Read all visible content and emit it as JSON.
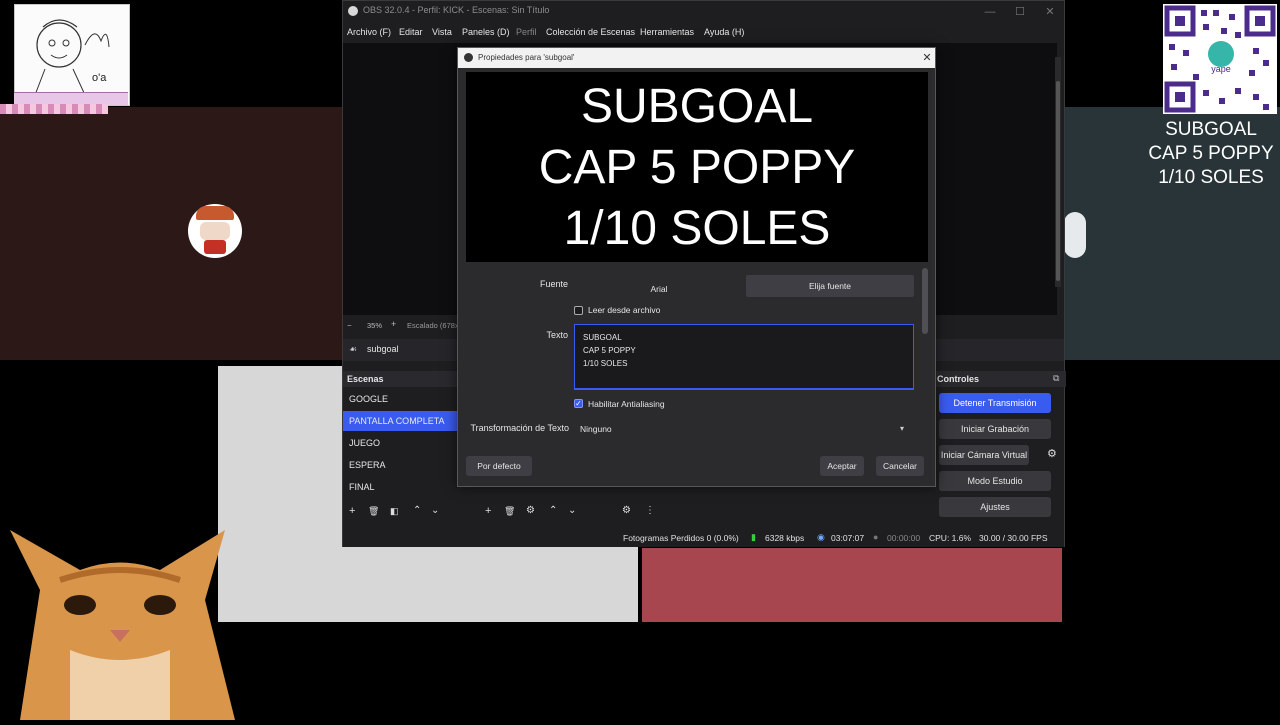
{
  "overlay": {
    "drawing_label": "o'a",
    "goal_lines": [
      "SUBGOAL",
      "CAP 5 POPPY",
      "1/10 SOLES"
    ]
  },
  "obs": {
    "title": "OBS 32.0.4 - Perfil: KICK - Escenas: Sin Título",
    "menu": [
      "Archivo (F)",
      "Editar",
      "Vista",
      "Paneles (D)",
      "Perfil",
      "Colección de Escenas",
      "Herramientas",
      "Ayuda (H)"
    ],
    "zoom": "35%",
    "zoom_mode": "Escalado (678x",
    "source_name": "subgoal",
    "scenes_title": "Escenas",
    "scenes": [
      "GOOGLE",
      "PANTALLA COMPLETA",
      "JUEGO",
      "ESPERA",
      "FINAL"
    ],
    "controls_title": "Controles",
    "controls": [
      "Detener Transmisión",
      "Iniciar Grabación",
      "Iniciar Cámara Virtual",
      "Modo Estudio",
      "Ajustes"
    ],
    "status": {
      "dropped": "Fotogramas Perdidos 0 (0.0%)",
      "bitrate": "6328 kbps",
      "stream_time": "03:07:07",
      "rec_time": "00:00:00",
      "cpu": "CPU: 1.6%",
      "fps": "30.00 / 30.00 FPS"
    },
    "colors": {
      "accent": "#3a5bf0",
      "bg": "#1e1e20"
    }
  },
  "dialog": {
    "title": "Propiedades para 'subgoal'",
    "preview_lines": [
      "SUBGOAL",
      "CAP 5 POPPY",
      "1/10 SOLES"
    ],
    "font_label": "Fuente",
    "font_value": "Arial",
    "font_button": "Elija fuente",
    "read_file_label": "Leer desde archivo",
    "read_file_checked": false,
    "text_label": "Texto",
    "text_value": "SUBGOAL\nCAP 5 POPPY\n1/10 SOLES",
    "antialias_label": "Habilitar Antialiasing",
    "antialias_checked": true,
    "transform_label": "Transformación de Texto",
    "transform_value": "Ninguno",
    "defaults_button": "Por defecto",
    "ok_button": "Aceptar",
    "cancel_button": "Cancelar"
  }
}
